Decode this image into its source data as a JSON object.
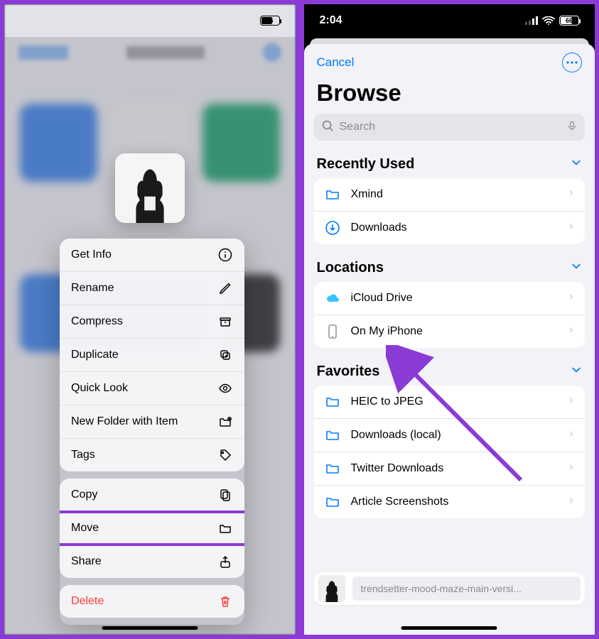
{
  "status": {
    "time": "2:04",
    "battery": "66"
  },
  "left": {
    "menu_groups": [
      [
        {
          "label": "Get Info",
          "icon": "info",
          "name": "get-info-item"
        },
        {
          "label": "Rename",
          "icon": "pencil",
          "name": "rename-item"
        },
        {
          "label": "Compress",
          "icon": "archive",
          "name": "compress-item"
        },
        {
          "label": "Duplicate",
          "icon": "duplicate",
          "name": "duplicate-item"
        },
        {
          "label": "Quick Look",
          "icon": "eye",
          "name": "quick-look-item"
        },
        {
          "label": "New Folder with Item",
          "icon": "folder-plus",
          "name": "new-folder-item"
        },
        {
          "label": "Tags",
          "icon": "tag",
          "name": "tags-item"
        }
      ],
      [
        {
          "label": "Copy",
          "icon": "copy",
          "name": "copy-item"
        },
        {
          "label": "Move",
          "icon": "folder",
          "name": "move-item",
          "highlight": true
        },
        {
          "label": "Share",
          "icon": "share",
          "name": "share-item"
        }
      ],
      [
        {
          "label": "Delete",
          "icon": "trash",
          "name": "delete-item",
          "destructive": true
        }
      ]
    ]
  },
  "right": {
    "cancel": "Cancel",
    "title": "Browse",
    "search_placeholder": "Search",
    "sections": {
      "recent": {
        "title": "Recently Used",
        "items": [
          {
            "label": "Xmind",
            "icon": "folder",
            "name": "row-xmind"
          },
          {
            "label": "Downloads",
            "icon": "download",
            "name": "row-downloads"
          }
        ]
      },
      "locations": {
        "title": "Locations",
        "items": [
          {
            "label": "iCloud Drive",
            "icon": "cloud",
            "name": "row-icloud"
          },
          {
            "label": "On My iPhone",
            "icon": "iphone",
            "name": "row-on-my-iphone",
            "gray": true,
            "annotate": true
          }
        ]
      },
      "favorites": {
        "title": "Favorites",
        "items": [
          {
            "label": "HEIC to JPEG",
            "icon": "folder",
            "name": "row-heic"
          },
          {
            "label": "Downloads (local)",
            "icon": "folder",
            "name": "row-dl-local"
          },
          {
            "label": "Twitter Downloads",
            "icon": "folder",
            "name": "row-twitter-dl"
          },
          {
            "label": "Article Screenshots",
            "icon": "folder",
            "name": "row-article-ss"
          }
        ]
      }
    },
    "move_file": "trendsetter-mood-maze-main-versi..."
  }
}
